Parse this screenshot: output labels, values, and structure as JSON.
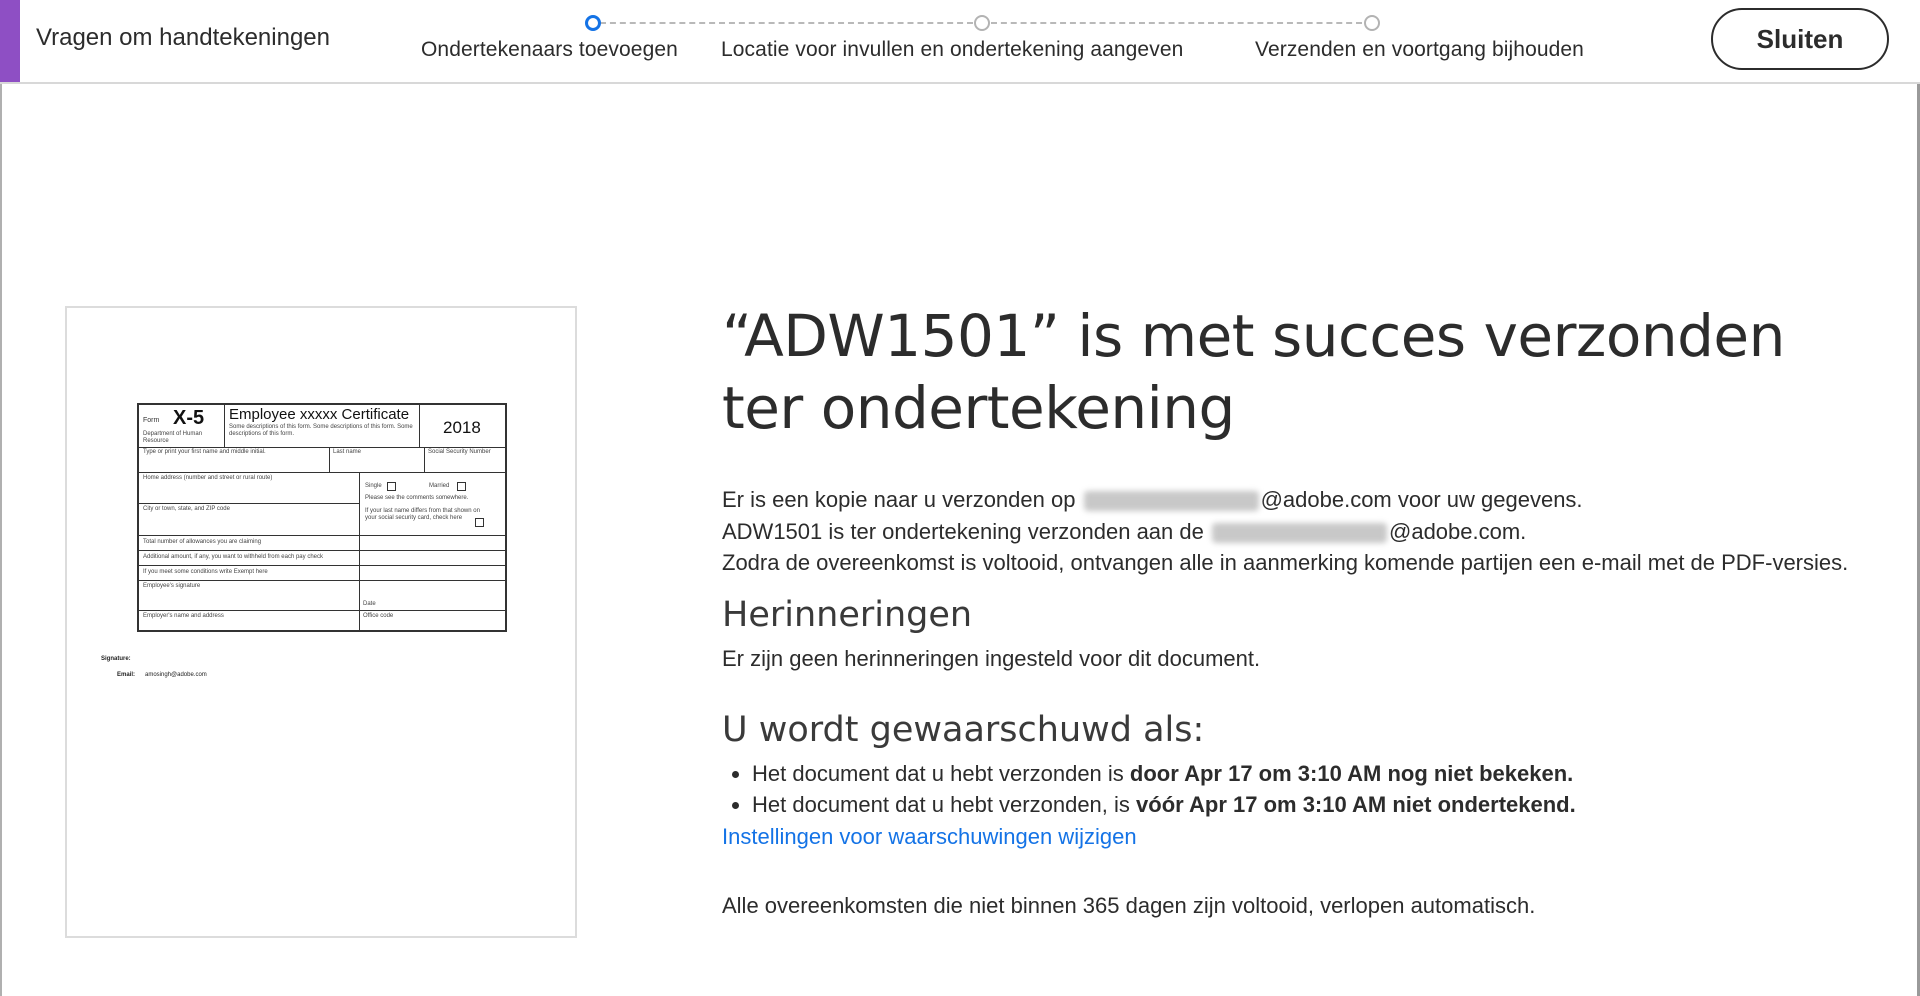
{
  "header": {
    "app_title": "Vragen om handtekeningen",
    "close_label": "Sluiten",
    "accent_color": "#8e4fc4",
    "steps": [
      {
        "label": "Ondertekenaars toevoegen",
        "active": true
      },
      {
        "label": "Locatie voor invullen en ondertekening aangeven",
        "active": false
      },
      {
        "label": "Verzenden en voortgang bijhouden",
        "active": false
      }
    ]
  },
  "thumbnail": {
    "form_label": "Form",
    "form_number": "X-5",
    "form_title": "Employee xxxxx Certificate",
    "form_year": "2018",
    "department": "Department of Human Resource",
    "description": "Some descriptions of this form. Some descriptions of this form. Some descriptions of this form.",
    "fields": {
      "first_name": "Type or print your first name and middle initial.",
      "last_name": "Last name",
      "ssn": "Social Security Number",
      "home_address": "Home address (number and street or rural route)",
      "single": "Single",
      "married": "Married",
      "comments": "Please see the comments somewhere.",
      "city": "City or town, state, and ZIP code",
      "last_name_differs": "If your last name differs from that shown on your social security card, check here",
      "allowances": "Total number of allowances you are claiming",
      "additional_amount": "Additional amount, if any, you want to withheld from each pay check",
      "exempt": "If you meet some conditions write Exempt here",
      "employee_signature": "Employee's signature",
      "date": "Date",
      "employer_name": "Employer's name and address",
      "office_code": "Office code"
    },
    "signature_label": "Signature:",
    "email_label": "Email:",
    "email_value": "amosingh@adobe.com"
  },
  "content": {
    "headline": "“ADW1501” is met succes verzonden ter ondertekening",
    "copy_prefix": "Er is een kopie naar u verzonden op",
    "copy_suffix": "@adobe.com voor uw gegevens.",
    "sent_prefix": "ADW1501 is ter ondertekening verzonden aan de",
    "sent_suffix": "@adobe.com.",
    "completion_note": "Zodra de overeenkomst is voltooid, ontvangen alle in aanmerking komende partijen een e-mail met de PDF-versies.",
    "reminders_title": "Herinneringen",
    "reminders_text": "Er zijn geen herinneringen ingesteld voor dit document.",
    "alerts_title": "U wordt gewaarschuwd als:",
    "alert1_prefix": "Het document dat u hebt verzonden is",
    "alert1_bold": "door Apr 17 om 3:10 AM nog niet bekeken.",
    "alert2_prefix": "Het document dat u hebt verzonden, is",
    "alert2_bold": "vóór Apr 17 om 3:10 AM niet ondertekend.",
    "alert_settings_link": "Instellingen voor waarschuwingen wijzigen",
    "expiry_note": "Alle overeenkomsten die niet binnen 365 dagen zijn voltooid, verlopen automatisch.",
    "link_color": "#1473e6"
  }
}
